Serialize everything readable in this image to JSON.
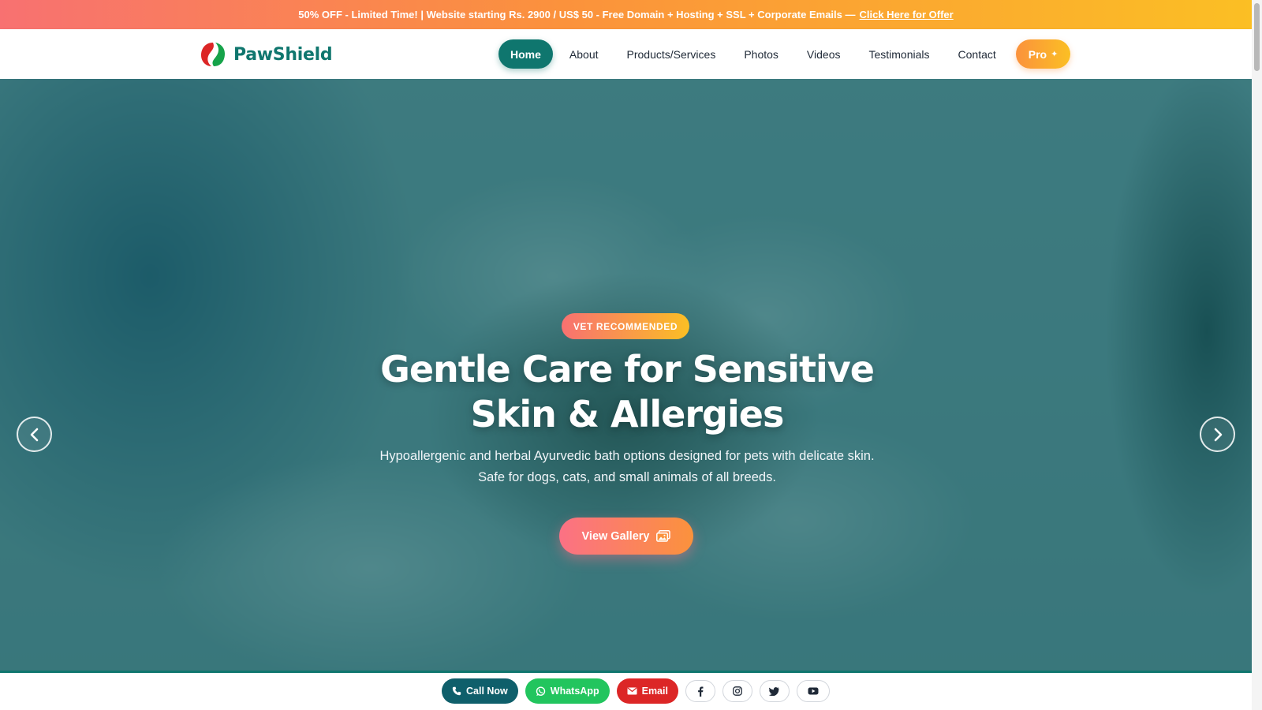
{
  "promo": {
    "text": "50% OFF - Limited Time! | Website starting Rs. 2900 / US$ 50 - Free Domain + Hosting + SSL + Corporate Emails —",
    "link_label": "Click Here for Offer"
  },
  "header": {
    "brand_name": "PawShield",
    "nav": [
      {
        "label": "Home"
      },
      {
        "label": "About"
      },
      {
        "label": "Products/Services"
      },
      {
        "label": "Photos"
      },
      {
        "label": "Videos"
      },
      {
        "label": "Testimonials"
      },
      {
        "label": "Contact"
      }
    ],
    "pro_label": "Pro"
  },
  "hero": {
    "badge": "VET RECOMMENDED",
    "title_line1": "Gentle Care for Sensitive",
    "title_line2": "Skin & Allergies",
    "description": "Hypoallergenic and herbal Ayurvedic bath options designed for pets with delicate skin. Safe for dogs, cats, and small animals of all breeds.",
    "cta_label": "View Gallery"
  },
  "contact_bar": {
    "call_label": "Call Now",
    "whatsapp_label": "WhatsApp",
    "email_label": "Email",
    "socials": [
      "facebook-icon",
      "instagram-icon",
      "twitter-icon",
      "youtube-icon"
    ]
  },
  "colors": {
    "brand_teal": "#0f766e",
    "promo_start": "#f87171",
    "promo_end": "#fbbf24",
    "cta_start": "#fb7185",
    "cta_end": "#fb923c",
    "whatsapp": "#22c55e",
    "email": "#dc2626"
  }
}
